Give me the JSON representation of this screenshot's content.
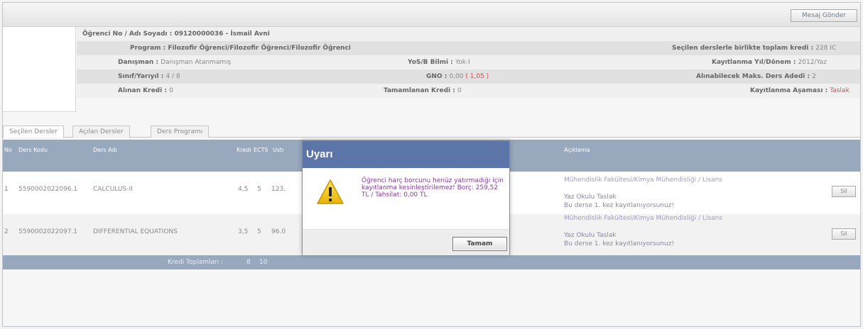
{
  "toolbar": {
    "message_button": "Mesaj Gönder"
  },
  "student": {
    "id_line": "Öğrenci No / Adı Soyadı : 09120000036 - İsmail Avni",
    "program_label": "Program : ",
    "program_value": "Filozofir Öğrenci/Filozofir Öğrenci/Filozofir Öğrenci",
    "total_credit_label": "Seçilen derslerle birlikte toplam kredi : ",
    "total_credit_value": "228 IC",
    "advisor_label": "Danışman : ",
    "advisor_value": "Danışman Atanmamış",
    "year_label": "YoS/B Bilmi : ",
    "year_value": "Yok-I",
    "reg_term_label": "Kayıtlanma Yıl/Dönem : ",
    "reg_term_value": "2012/Yaz",
    "class_label": "Sınıf/Yarıyıl : ",
    "class_value": "4 / 8",
    "gpa_label": "GNO : ",
    "gpa_value": "0,00",
    "gpa_extra": "( 1,05 )",
    "max_course_label": "Alınabilecek Maks. Ders Adedi : ",
    "max_course_value": "2",
    "taken_credit_label": "Alınan Kredi : ",
    "taken_credit_value": "0",
    "completed_credit_label": "Tamamlanan Kredi : ",
    "completed_credit_value": "0",
    "reg_status_label": "Kayıtlanma Aşaması : ",
    "reg_status_value": "Taslak"
  },
  "tabs": [
    "Seçilen Dersler",
    "Açılan Dersler",
    "Ders Programı"
  ],
  "grid": {
    "headers": {
      "no": "No",
      "code": "Ders Kodu",
      "name": "Ders Adı",
      "credit": "Kredi",
      "ects": "ECTS",
      "teacher": "Ustı",
      "desc": "Açıklama"
    },
    "rows": [
      {
        "no": "1",
        "code": "5590002022096.1",
        "name": "CALCULUS-II",
        "credit": "4,5",
        "ects": "5",
        "teacher": "123.",
        "desc1": "Mühendislik Fakültesi/Kimya Mühendisliği / Lisans",
        "desc2": "Yaz Okulu Taslak",
        "desc3": "Bu derse 1. kez kayıtlanıyorsunuz!",
        "button": "Sil"
      },
      {
        "no": "2",
        "code": "5590002022097.1",
        "name": "DIFFERENTIAL EQUATIONS",
        "credit": "3,5",
        "ects": "5",
        "teacher": "96.0",
        "desc1": "Mühendislik Fakültesi/Kimya Mühendisliği / Lisans",
        "desc2": "Yaz Okulu Taslak",
        "desc3": "Bu derse 1. kez kayıtlanıyorsunuz!",
        "button": "Sil"
      }
    ],
    "totals_label": "Kredi Toplamları :",
    "totals_credit": "8",
    "totals_ects": "10"
  },
  "dialog": {
    "title": "Uyarı",
    "message": "Öğrenci harç borcunu henüz yatırmadığı için kayıtlanma kesinleştirilemez! Borç: 259,52 TL / Tahsilat: 0,00 TL",
    "ok_button": "Tamam"
  },
  "colors": {
    "header_bg": "#98a8bd",
    "dialog_title_bg": "#5b75a9",
    "status_red": "#d84a4a",
    "warning_yellow": "#f2c200"
  }
}
